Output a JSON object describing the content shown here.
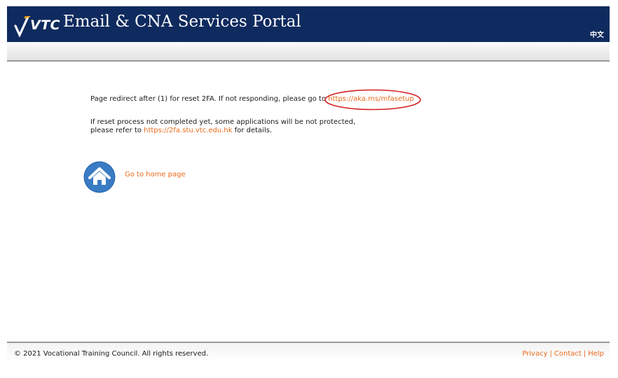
{
  "header": {
    "logo_text": "VTC",
    "title": "Email & CNA Services Portal",
    "language_link": "中文"
  },
  "content": {
    "redirect_text": "Page redirect after (1) for reset 2FA. If not responding, please go to ",
    "mfa_link": "https://aka.ms/mfasetup",
    "notice_line1": "If reset process not completed yet, some applications will be not protected,",
    "notice_line2_prefix": "please refer to ",
    "twofa_link": "https://2fa.stu.vtc.edu.hk",
    "notice_line2_suffix": " for details.",
    "home_link": "Go to home page"
  },
  "footer": {
    "copyright": "© 2021 Vocational Training Council. All rights reserved.",
    "links": [
      "Privacy",
      "Contact",
      "Help"
    ],
    "separator": "|"
  },
  "colors": {
    "header_bg": "#0f2a5e",
    "link": "#ea6a1c",
    "highlight_circle": "#d42020",
    "home_icon": "#2d6db5"
  }
}
